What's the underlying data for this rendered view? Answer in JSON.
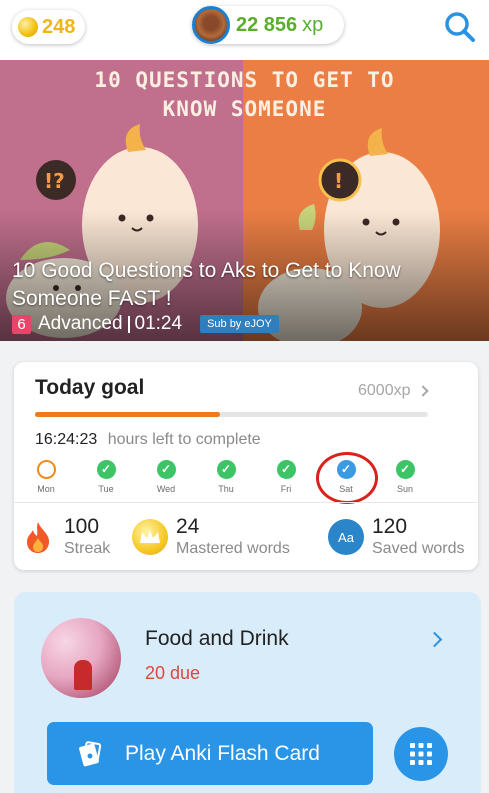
{
  "header": {
    "coins": "248",
    "xp_value": "22 856",
    "xp_unit": "xp",
    "search_icon": "search-icon",
    "colors": {
      "coin": "#f0b51b",
      "xp": "#5aae2e",
      "accent": "#2a92e0"
    }
  },
  "hero": {
    "banner_line1": "10 QUESTIONS TO GET TO",
    "banner_line2": "KNOW SOMEONE",
    "title": "10 Good Questions to Aks to Get to Know Someone FAST !",
    "level_number": "6",
    "level_label": "Advanced",
    "duration": "01:24",
    "subtitle_badge": "Sub by eJOY"
  },
  "goal": {
    "title": "Today goal",
    "target": "6000xp",
    "progress_fraction": 0.47,
    "timer": "16:24:23",
    "timer_label": "hours left to complete",
    "days": [
      {
        "name": "Mon",
        "status": "open"
      },
      {
        "name": "Tue",
        "status": "done"
      },
      {
        "name": "Wed",
        "status": "done"
      },
      {
        "name": "Thu",
        "status": "done"
      },
      {
        "name": "Fri",
        "status": "done"
      },
      {
        "name": "Sat",
        "status": "current"
      },
      {
        "name": "Sun",
        "status": "done"
      }
    ],
    "stats": [
      {
        "value": "100",
        "label": "Streak",
        "icon": "flame-icon"
      },
      {
        "value": "24",
        "label": "Mastered words",
        "icon": "crown-icon"
      },
      {
        "value": "120",
        "label": "Saved words",
        "icon": "aa-icon",
        "icon_text": "Aa"
      }
    ]
  },
  "deck": {
    "title": "Food and Drink",
    "due": "20 due",
    "play_label": "Play Anki Flash Card",
    "grid_icon": "grid-icon"
  }
}
